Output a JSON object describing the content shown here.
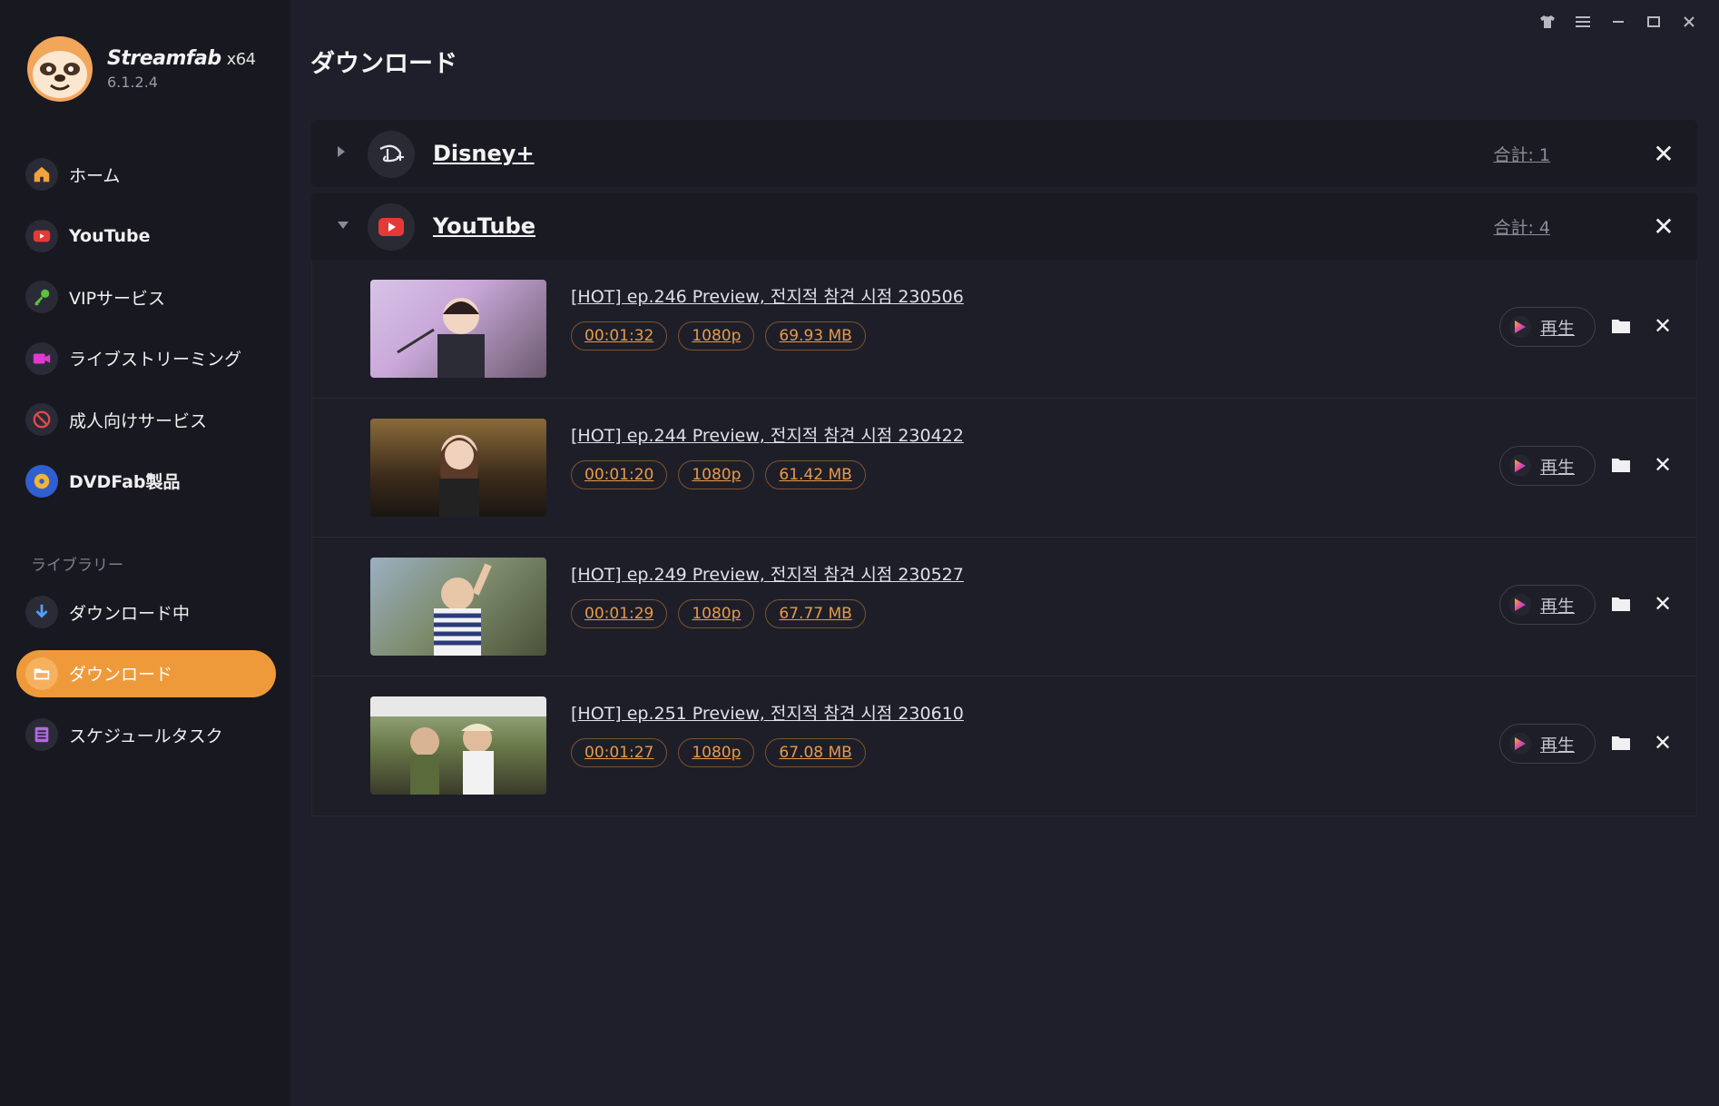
{
  "app": {
    "name": "Streamfab",
    "arch": "x64",
    "version": "6.1.2.4"
  },
  "window_controls": [
    "tshirt-icon",
    "menu-icon",
    "minimize-icon",
    "maximize-icon",
    "close-icon"
  ],
  "sidebar": {
    "items": [
      {
        "label": "ホーム",
        "icon": "home-icon"
      },
      {
        "label": "YouTube",
        "icon": "youtube-icon"
      },
      {
        "label": "VIPサービス",
        "icon": "key-icon"
      },
      {
        "label": "ライブストリーミング",
        "icon": "camera-icon"
      },
      {
        "label": "成人向けサービス",
        "icon": "adult-icon"
      },
      {
        "label": "DVDFab製品",
        "icon": "dvdfab-icon"
      }
    ],
    "library_label": "ライブラリー",
    "library_items": [
      {
        "label": "ダウンロード中",
        "icon": "download-icon"
      },
      {
        "label": "ダウンロード",
        "icon": "folder-icon",
        "active": true
      },
      {
        "label": "スケジュールタスク",
        "icon": "schedule-icon"
      }
    ]
  },
  "page_title": "ダウンロード",
  "groups": [
    {
      "name": "Disney+",
      "total": "合計: 1",
      "expanded": false
    },
    {
      "name": "YouTube",
      "total": "合計: 4",
      "expanded": true
    }
  ],
  "downloads": [
    {
      "title": "[HOT] ep.246 Preview, 전지적 참견 시점 230506",
      "duration": "00:01:32",
      "quality": "1080p",
      "size": "69.93 MB",
      "play_label": "再生"
    },
    {
      "title": "[HOT] ep.244 Preview, 전지적 참견 시점 230422",
      "duration": "00:01:20",
      "quality": "1080p",
      "size": "61.42 MB",
      "play_label": "再生"
    },
    {
      "title": "[HOT] ep.249 Preview, 전지적 참견 시점 230527",
      "duration": "00:01:29",
      "quality": "1080p",
      "size": "67.77 MB",
      "play_label": "再生"
    },
    {
      "title": "[HOT] ep.251 Preview, 전지적 참견 시점 230610",
      "duration": "00:01:27",
      "quality": "1080p",
      "size": "67.08 MB",
      "play_label": "再生"
    }
  ],
  "colors": {
    "accent": "#ef9a3a",
    "tag_text": "#e89a48",
    "background": "#1f1f2b",
    "sidebar": "#181820"
  }
}
